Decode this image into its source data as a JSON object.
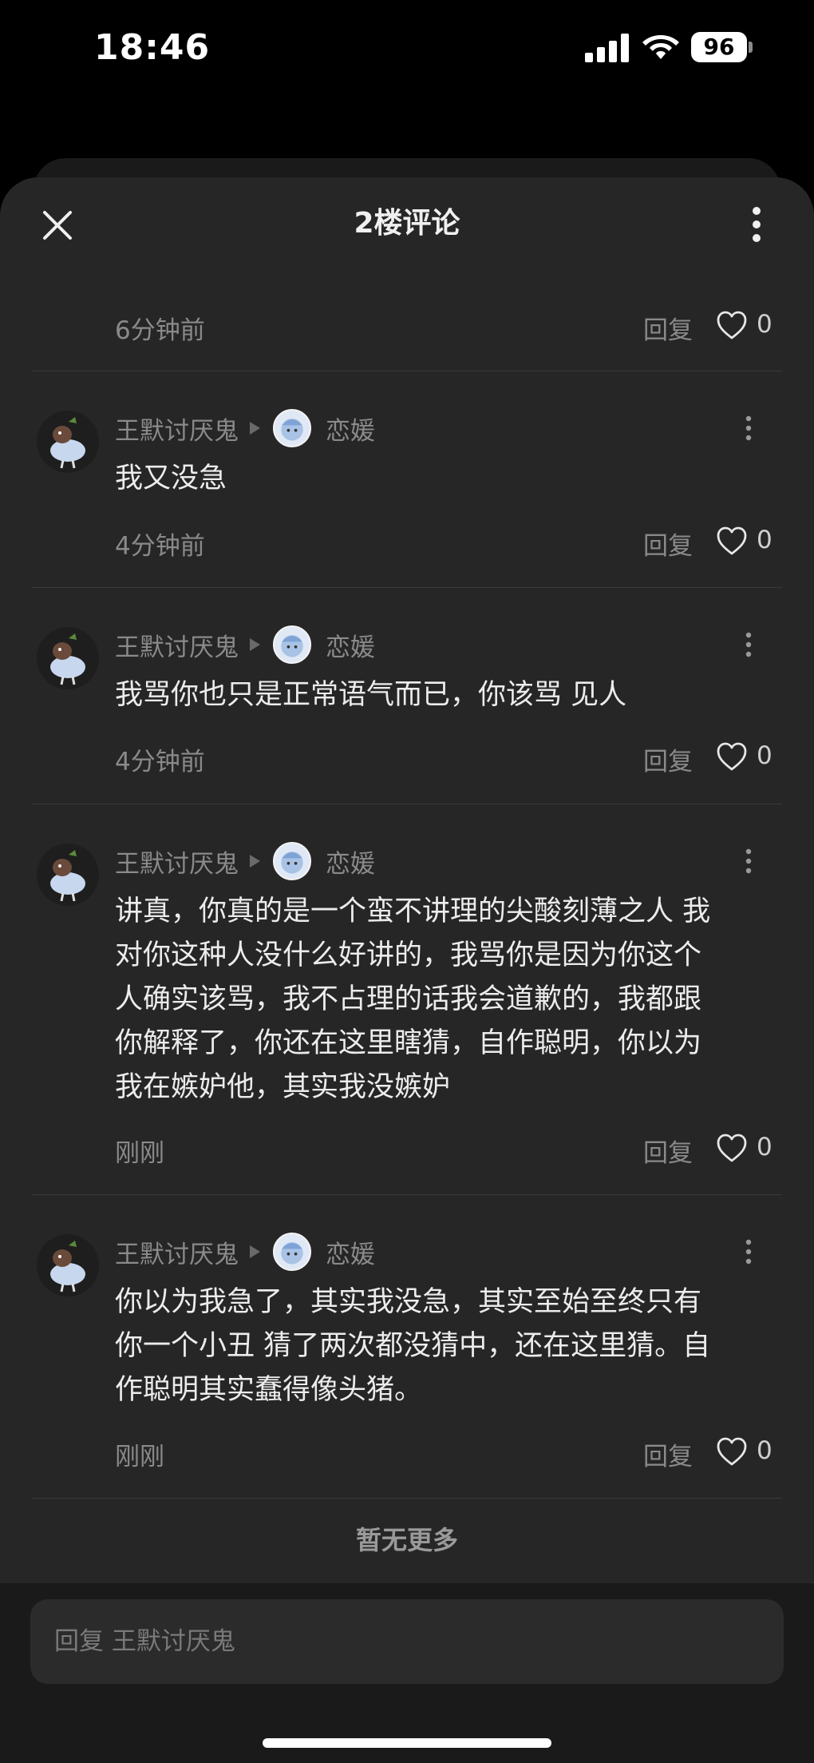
{
  "status_bar": {
    "time": "18:46",
    "battery": "96"
  },
  "header": {
    "title": "2楼评论"
  },
  "top_meta": {
    "time": "6分钟前",
    "reply": "回复",
    "likes": "0"
  },
  "comments": [
    {
      "author": "王默讨厌鬼",
      "target": "恋媛",
      "text": "我又没急",
      "time": "4分钟前",
      "reply": "回复",
      "likes": "0"
    },
    {
      "author": "王默讨厌鬼",
      "target": "恋媛",
      "text": "我骂你也只是正常语气而已，你该骂 见人",
      "time": "4分钟前",
      "reply": "回复",
      "likes": "0"
    },
    {
      "author": "王默讨厌鬼",
      "target": "恋媛",
      "text": "讲真，你真的是一个蛮不讲理的尖酸刻薄之人 我\n对你这种人没什么好讲的，我骂你是因为你这个\n人确实该骂，我不占理的话我会道歉的，我都跟\n你解释了，你还在这里瞎猜，自作聪明，你以为\n我在嫉妒他，其实我没嫉妒",
      "time": "刚刚",
      "reply": "回复",
      "likes": "0"
    },
    {
      "author": "王默讨厌鬼",
      "target": "恋媛",
      "text": "你以为我急了，其实我没急，其实至始至终只有\n你一个小丑 猜了两次都没猜中，还在这里猜。自\n作聪明其实蠢得像头猪。",
      "time": "刚刚",
      "reply": "回复",
      "likes": "0"
    }
  ],
  "footer": {
    "no_more": "暂无更多"
  },
  "reply_input": {
    "placeholder": "回复 王默讨厌鬼"
  },
  "icons": {
    "close": "close-icon",
    "more": "more-vertical-icon",
    "like": "heart-outline-icon",
    "kebab": "more-vertical-icon"
  },
  "colors": {
    "sheet_bg": "#262626",
    "text_primary": "#ececec",
    "text_secondary": "#8a8a8a",
    "separator": "#3a3a3a"
  }
}
